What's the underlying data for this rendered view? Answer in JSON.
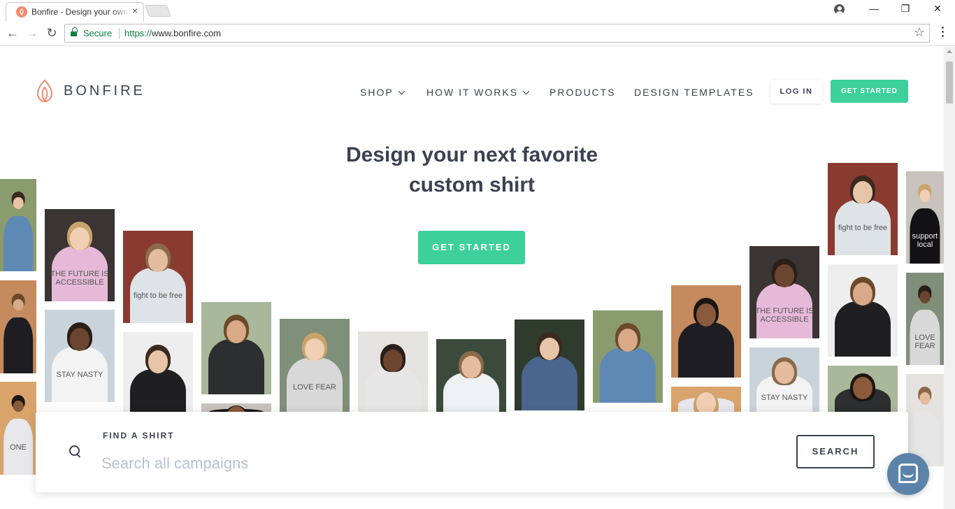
{
  "browser": {
    "tab_title": "Bonfire - Design your own",
    "tab_close": "×",
    "secure_label": "Secure",
    "url_scheme": "https://",
    "url_host": "www.bonfire.com",
    "star": "☆",
    "minimize": "—",
    "maximize": "❐",
    "close": "✕",
    "back": "←",
    "forward": "→",
    "reload": "↻"
  },
  "header": {
    "logo_text": "BONFIRE",
    "nav": [
      {
        "label": "SHOP",
        "dropdown": true
      },
      {
        "label": "HOW IT WORKS",
        "dropdown": true
      },
      {
        "label": "PRODUCTS",
        "dropdown": false
      },
      {
        "label": "DESIGN TEMPLATES",
        "dropdown": false
      }
    ],
    "login_label": "LOG IN",
    "get_started_label": "GET STARTED"
  },
  "hero": {
    "title_line1": "Design your next favorite",
    "title_line2": "custom shirt",
    "cta_label": "GET STARTED"
  },
  "tiles": [
    {
      "tee": "",
      "bg": "#8a9b6e",
      "shirt": "#5e89b5"
    },
    {
      "tee": "",
      "bg": "#c58a5d",
      "shirt": "#1e1e22"
    },
    {
      "tee": "ONE",
      "bg": "#d9a46b",
      "shirt": "#e7e7ec"
    },
    {
      "tee": "THE FUTURE IS ACCESSIBLE",
      "bg": "#3a3432",
      "shirt": "#e6b9d9"
    },
    {
      "tee": "STAY NASTY",
      "bg": "#c9d3db",
      "shirt": "#f3f3f3"
    },
    {
      "tee": "fight to be free",
      "bg": "#8b3a2f",
      "shirt": "#dde3e6"
    },
    {
      "tee": "",
      "bg": "#eeeeee",
      "shirt": "#1f1f22"
    },
    {
      "tee": "",
      "bg": "#a9b79a",
      "shirt": "#2c2e2f"
    },
    {
      "tee": "support local",
      "bg": "#c9c3bd",
      "shirt": "#121214"
    },
    {
      "tee": "LOVE FEAR",
      "bg": "#7f8f7a",
      "shirt": "#d8d8d8"
    },
    {
      "tee": "",
      "bg": "#e5e3e0",
      "shirt": "#e6e6e6"
    },
    {
      "tee": "",
      "bg": "#3c4a3b",
      "shirt": "#eef1f3"
    },
    {
      "tee": "",
      "bg": "#2f3b2c",
      "shirt": "#4a668e"
    }
  ],
  "search": {
    "label": "FIND A SHIRT",
    "placeholder": "Search all campaigns",
    "button_label": "SEARCH"
  },
  "icons": {
    "logo": "flame-logo-icon",
    "search": "search-icon",
    "chat": "chat-icon",
    "lock": "lock-icon"
  },
  "colors": {
    "accent": "#3dd09a",
    "text": "#3b4150",
    "chat": "#5b83a9",
    "logo": "#f08a70"
  }
}
